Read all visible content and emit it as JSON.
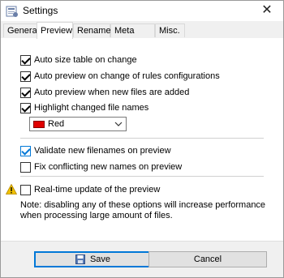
{
  "window": {
    "title": "Settings",
    "close_glyph": "✕"
  },
  "tabs": [
    {
      "label": "General"
    },
    {
      "label": "Preview"
    },
    {
      "label": "Rename"
    },
    {
      "label": "Meta Tags"
    },
    {
      "label": "Misc."
    }
  ],
  "active_tab": "Preview",
  "options": {
    "auto_size": {
      "label": "Auto size table on change",
      "checked": true
    },
    "auto_preview_rules": {
      "label": "Auto preview on change of rules configurations",
      "checked": true
    },
    "auto_preview_files": {
      "label": "Auto preview when new files are added",
      "checked": true
    },
    "highlight": {
      "label": "Highlight changed file names",
      "checked": true
    },
    "validate": {
      "label": "Validate new filenames on preview",
      "checked": true
    },
    "fix_conflicting": {
      "label": "Fix conflicting new names on preview",
      "checked": false
    },
    "realtime": {
      "label": "Real-time update of the preview",
      "checked": false
    }
  },
  "highlight_color": {
    "label": "Red",
    "swatch": "#e00000"
  },
  "note": "Note: disabling any of these options will increase performance when processing large amount of files.",
  "buttons": {
    "save": "Save",
    "cancel": "Cancel"
  },
  "colors": {
    "accent": "#0078d7",
    "warning": "#f0c000"
  }
}
